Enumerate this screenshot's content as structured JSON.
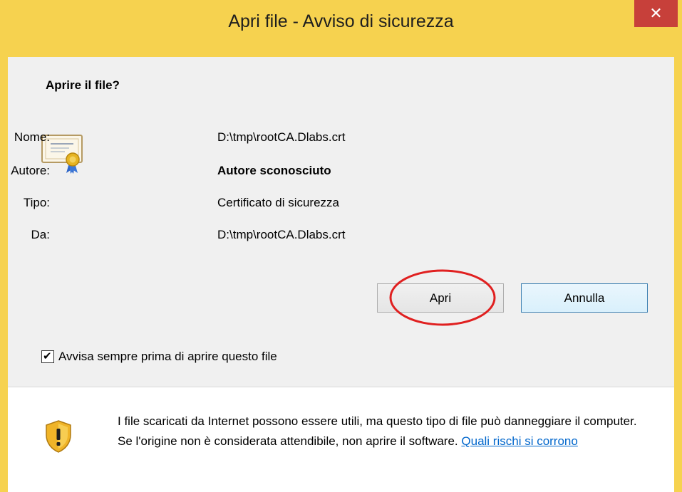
{
  "window": {
    "title": "Apri file - Avviso di sicurezza",
    "close_icon": "close-icon",
    "close_glyph": "✕"
  },
  "dialog": {
    "heading": "Aprire il file?",
    "icon": "certificate-icon",
    "fields": [
      {
        "label": "Nome:",
        "value": "D:\\tmp\\rootCA.Dlabs.crt"
      },
      {
        "label": "Autore:",
        "value": "Autore sconosciuto"
      },
      {
        "label": "Tipo:",
        "value": "Certificato di sicurezza"
      },
      {
        "label": "Da:",
        "value": "D:\\tmp\\rootCA.Dlabs.crt"
      }
    ],
    "buttons": {
      "open_label": "Apri",
      "cancel_label": "Annulla"
    },
    "checkbox": {
      "label": "Avvisa sempre prima di aprire questo file",
      "checked": true,
      "check_glyph": "✔"
    }
  },
  "warning": {
    "icon": "shield-warning-icon",
    "text": "I file scaricati da Internet possono essere utili, ma questo tipo di file può danneggiare il computer. Se l'origine non è considerata attendibile, non aprire il software.",
    "link_text": "Quali rischi si corrono"
  },
  "colors": {
    "title_bar": "#f6d24f",
    "close_button": "#c7403a",
    "highlight_ellipse": "#e02020",
    "link": "#0066cc"
  }
}
